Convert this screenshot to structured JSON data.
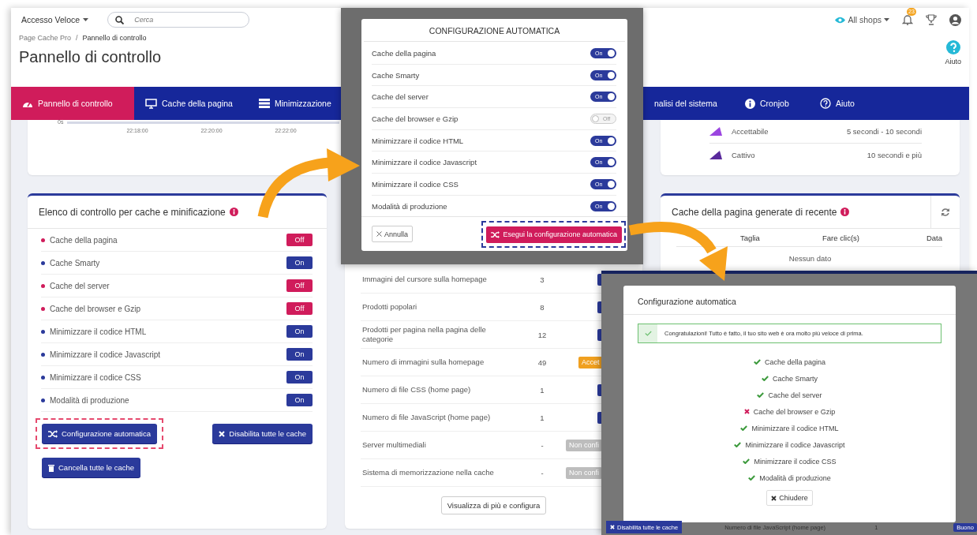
{
  "header": {
    "quick_access": "Accesso Veloce",
    "search": {
      "placeholder": "Cerca"
    },
    "shop_selector": "All shops",
    "notification_count": "23"
  },
  "breadcrumb": {
    "items": [
      "Page Cache Pro",
      "Pannello di controllo"
    ],
    "separator": "/"
  },
  "page_title": "Pannello di controllo",
  "help": {
    "label": "Aiuto"
  },
  "nav_tabs": [
    {
      "label": "Pannello di controllo",
      "selected": true
    },
    {
      "label": "Cache della pagina",
      "selected": false
    },
    {
      "label": "Minimizzazione",
      "selected": false
    },
    {
      "label": "nalisi del sistema",
      "selected": false
    },
    {
      "label": "Cronjob",
      "selected": false
    },
    {
      "label": "Aiuto",
      "selected": false
    }
  ],
  "timeline": {
    "y_label": "0s",
    "x_ticks": [
      "22:18:00",
      "22:20:00",
      "22:22:00"
    ]
  },
  "speed_legend": {
    "items": [
      {
        "label": "Accettabile",
        "range": "5 secondi - 10 secondi",
        "color": "#9b45e0"
      },
      {
        "label": "Cattivo",
        "range": "10 secondi e più",
        "color": "#5a2a9c"
      }
    ]
  },
  "checklist": {
    "title": "Elenco di controllo per cache e minificazione",
    "items": [
      {
        "label": "Cache della pagina",
        "on": false,
        "status": "Off"
      },
      {
        "label": "Cache Smarty",
        "on": true,
        "status": "On"
      },
      {
        "label": "Cache del server",
        "on": false,
        "status": "Off"
      },
      {
        "label": "Cache del browser e Gzip",
        "on": false,
        "status": "Off"
      },
      {
        "label": "Minimizzare il codice HTML",
        "on": true,
        "status": "On"
      },
      {
        "label": "Minimizzare il codice Javascript",
        "on": true,
        "status": "On"
      },
      {
        "label": "Minimizzare il codice CSS",
        "on": true,
        "status": "On"
      },
      {
        "label": "Modalità di produzione",
        "on": true,
        "status": "On"
      }
    ],
    "buttons": [
      {
        "label": "Configurazione automatica",
        "kind": "auto",
        "highlighted": true
      },
      {
        "label": "Disabilita tutte le cache",
        "kind": "disable",
        "highlighted": false
      },
      {
        "label": "Cancella tutte le cache",
        "kind": "clear",
        "highlighted": false
      }
    ]
  },
  "checks_table": {
    "rows": [
      {
        "label": "Immagini del cursore sulla homepage",
        "value": "3",
        "kind": "good"
      },
      {
        "label": "Prodotti popolari",
        "value": "8",
        "kind": "good"
      },
      {
        "label": "Prodotti per pagina nella pagina delle categorie",
        "value": "12",
        "kind": "good"
      },
      {
        "label": "Numero di immagini sulla homepage",
        "value": "49",
        "kind": "acceptable",
        "badge": "Accet"
      },
      {
        "label": "Numero di file CSS (home page)",
        "value": "1",
        "kind": "good"
      },
      {
        "label": "Numero di file JavaScript (home page)",
        "value": "1",
        "kind": "good"
      },
      {
        "label": "Server multimediali",
        "value": "-",
        "kind": "not-configured",
        "badge": "Non confi"
      },
      {
        "label": "Sistema di memorizzazione nella cache",
        "value": "-",
        "kind": "not-configured",
        "badge": "Non confi"
      }
    ],
    "button": "Visualizza di più e configura"
  },
  "recent_cache": {
    "title": "Cache della pagina generate di recente",
    "columns": [
      "Taglia",
      "Fare clic(s)",
      "Data"
    ],
    "empty": "Nessun dato"
  },
  "config_modal": {
    "title": "CONFIGURAZIONE AUTOMATICA",
    "toggles": [
      {
        "label": "Cache della pagina",
        "on": true,
        "state_label": "On"
      },
      {
        "label": "Cache Smarty",
        "on": true,
        "state_label": "On"
      },
      {
        "label": "Cache del server",
        "on": true,
        "state_label": "On"
      },
      {
        "label": "Cache del browser e Gzip",
        "on": false,
        "state_label": "Off"
      },
      {
        "label": "Minimizzare il codice HTML",
        "on": true,
        "state_label": "On"
      },
      {
        "label": "Minimizzare il codice Javascript",
        "on": true,
        "state_label": "On"
      },
      {
        "label": "Minimizzare il codice CSS",
        "on": true,
        "state_label": "On"
      },
      {
        "label": "Modalità di produzione",
        "on": true,
        "state_label": "On"
      }
    ],
    "cancel": "Annulla",
    "run": {
      "label": "Esegui la configurazione automatica",
      "highlighted": true
    }
  },
  "result_modal": {
    "title": "Configurazione automatica",
    "alert": "Congratulazioni! Tutto è fatto, il tuo sito web è ora molto più veloce di prima.",
    "items": [
      {
        "label": "Cache della pagina",
        "success": true
      },
      {
        "label": "Cache Smarty",
        "success": true
      },
      {
        "label": "Cache del server",
        "success": true
      },
      {
        "label": "Cache del browser e Gzip",
        "success": false
      },
      {
        "label": "Minimizzare il codice HTML",
        "success": true
      },
      {
        "label": "Minimizzare il codice Javascript",
        "success": true
      },
      {
        "label": "Minimizzare il codice CSS",
        "success": true
      },
      {
        "label": "Modalità di produzione",
        "success": true
      }
    ],
    "close": "Chiudere",
    "background": {
      "button": "Disabilita tutte le cache",
      "row": {
        "label": "Numero di file JavaScript (home page)",
        "value": "1",
        "badge": "Buono"
      }
    }
  }
}
